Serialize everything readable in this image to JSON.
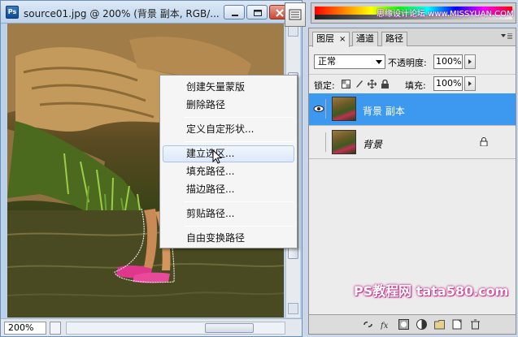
{
  "document": {
    "title": "source01.jpg @ 200% (背景 副本, RGB/...",
    "zoom": "200%"
  },
  "context_menu": {
    "items": [
      {
        "label": "创建矢量蒙版"
      },
      {
        "label": "删除路径"
      },
      {
        "label": "定义自定形状..."
      },
      {
        "label": "建立选区...",
        "highlighted": true
      },
      {
        "label": "填充路径..."
      },
      {
        "label": "描边路径..."
      },
      {
        "label": "剪贴路径..."
      },
      {
        "label": "自由变换路径"
      }
    ]
  },
  "layers_panel": {
    "tabs": [
      {
        "label": "图层",
        "active": true
      },
      {
        "label": "通道"
      },
      {
        "label": "路径"
      }
    ],
    "blend_mode": "正常",
    "opacity_label": "不透明度:",
    "opacity_value": "100%",
    "lock_label": "锁定:",
    "fill_label": "填充:",
    "fill_value": "100%",
    "layers": [
      {
        "name": "背景 副本",
        "selected": true,
        "visible": true
      },
      {
        "name": "背景",
        "selected": false,
        "visible": false,
        "locked": true
      }
    ]
  },
  "watermarks": {
    "top": "思缘设计论坛 www.MISSYUAN.COM",
    "bottom": "PS教程网 tata580.com"
  },
  "colors": {
    "selection_blue": "#3d98f0",
    "title_bar": "#bcd3ec",
    "close_button": "#c44a34"
  },
  "icons": [
    "ps-app-icon",
    "minimize-icon",
    "maximize-icon",
    "close-icon",
    "panel-toggle-icon",
    "eye-icon",
    "lock-icon",
    "cursor-arrow-icon"
  ]
}
